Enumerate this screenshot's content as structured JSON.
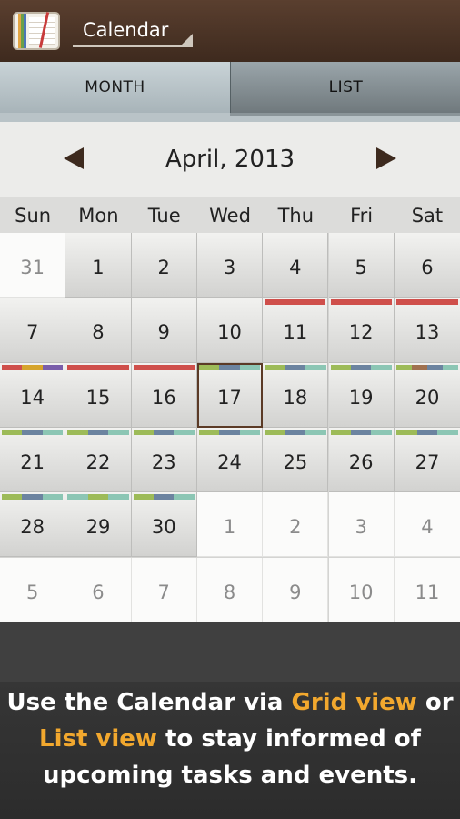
{
  "app": {
    "icon": "planner-book-icon",
    "spinner_label": "Calendar"
  },
  "tabs": [
    {
      "label": "MONTH",
      "selected": true
    },
    {
      "label": "LIST",
      "selected": false
    }
  ],
  "calendar": {
    "month_title": "April, 2013",
    "prev_icon": "triangle-left-icon",
    "next_icon": "triangle-right-icon",
    "weekdays": [
      "Sun",
      "Mon",
      "Tue",
      "Wed",
      "Thu",
      "Fri",
      "Sat"
    ],
    "today": "17",
    "weeks": [
      [
        {
          "day": "31",
          "current": false,
          "events": []
        },
        {
          "day": "1",
          "current": true,
          "events": []
        },
        {
          "day": "2",
          "current": true,
          "events": []
        },
        {
          "day": "3",
          "current": true,
          "events": []
        },
        {
          "day": "4",
          "current": true,
          "events": []
        },
        {
          "day": "5",
          "current": true,
          "events": []
        },
        {
          "day": "6",
          "current": true,
          "events": []
        }
      ],
      [
        {
          "day": "7",
          "current": true,
          "events": []
        },
        {
          "day": "8",
          "current": true,
          "events": []
        },
        {
          "day": "9",
          "current": true,
          "events": []
        },
        {
          "day": "10",
          "current": true,
          "events": []
        },
        {
          "day": "11",
          "current": true,
          "events": [
            "#cf4f4b"
          ]
        },
        {
          "day": "12",
          "current": true,
          "events": [
            "#cf4f4b"
          ]
        },
        {
          "day": "13",
          "current": true,
          "events": [
            "#cf4f4b"
          ]
        }
      ],
      [
        {
          "day": "14",
          "current": true,
          "events": [
            "#cf4f4b",
            "#d6a42c",
            "#7a5eaa"
          ]
        },
        {
          "day": "15",
          "current": true,
          "events": [
            "#cf4f4b"
          ]
        },
        {
          "day": "16",
          "current": true,
          "events": [
            "#cf4f4b"
          ]
        },
        {
          "day": "17",
          "current": true,
          "events": [
            "#9dbb58",
            "#6c84a0",
            "#8cc6b4"
          ]
        },
        {
          "day": "18",
          "current": true,
          "events": [
            "#9dbb58",
            "#6c84a0",
            "#8cc6b4"
          ]
        },
        {
          "day": "19",
          "current": true,
          "events": [
            "#9dbb58",
            "#6c84a0",
            "#8cc6b4"
          ]
        },
        {
          "day": "20",
          "current": true,
          "events": [
            "#9dbb58",
            "#a0714f",
            "#6c84a0",
            "#8cc6b4"
          ]
        }
      ],
      [
        {
          "day": "21",
          "current": true,
          "events": [
            "#9dbb58",
            "#6c84a0",
            "#8cc6b4"
          ]
        },
        {
          "day": "22",
          "current": true,
          "events": [
            "#9dbb58",
            "#6c84a0",
            "#8cc6b4"
          ]
        },
        {
          "day": "23",
          "current": true,
          "events": [
            "#9dbb58",
            "#6c84a0",
            "#8cc6b4"
          ]
        },
        {
          "day": "24",
          "current": true,
          "events": [
            "#9dbb58",
            "#6c84a0",
            "#8cc6b4"
          ]
        },
        {
          "day": "25",
          "current": true,
          "events": [
            "#9dbb58",
            "#6c84a0",
            "#8cc6b4"
          ]
        },
        {
          "day": "26",
          "current": true,
          "events": [
            "#9dbb58",
            "#6c84a0",
            "#8cc6b4"
          ]
        },
        {
          "day": "27",
          "current": true,
          "events": [
            "#9dbb58",
            "#6c84a0",
            "#8cc6b4"
          ]
        }
      ],
      [
        {
          "day": "28",
          "current": true,
          "events": [
            "#9dbb58",
            "#6c84a0",
            "#8cc6b4"
          ]
        },
        {
          "day": "29",
          "current": true,
          "events": [
            "#8cc6b4",
            "#9dbb58",
            "#8cc6b4"
          ]
        },
        {
          "day": "30",
          "current": true,
          "events": [
            "#9dbb58",
            "#6c84a0",
            "#8cc6b4"
          ]
        },
        {
          "day": "1",
          "current": false,
          "events": []
        },
        {
          "day": "2",
          "current": false,
          "events": []
        },
        {
          "day": "3",
          "current": false,
          "events": []
        },
        {
          "day": "4",
          "current": false,
          "events": []
        }
      ],
      [
        {
          "day": "5",
          "current": false,
          "events": []
        },
        {
          "day": "6",
          "current": false,
          "events": []
        },
        {
          "day": "7",
          "current": false,
          "events": []
        },
        {
          "day": "8",
          "current": false,
          "events": []
        },
        {
          "day": "9",
          "current": false,
          "events": []
        },
        {
          "day": "10",
          "current": false,
          "events": []
        },
        {
          "day": "11",
          "current": false,
          "events": []
        }
      ]
    ]
  },
  "promo": {
    "line1_a": "Use the Calendar via ",
    "line1_b": "Grid view",
    "line1_c": " or",
    "line2_a": "List view",
    "line2_b": " to stay informed of",
    "line3": "upcoming tasks and events.",
    "highlight_color": "#f2a82e"
  }
}
